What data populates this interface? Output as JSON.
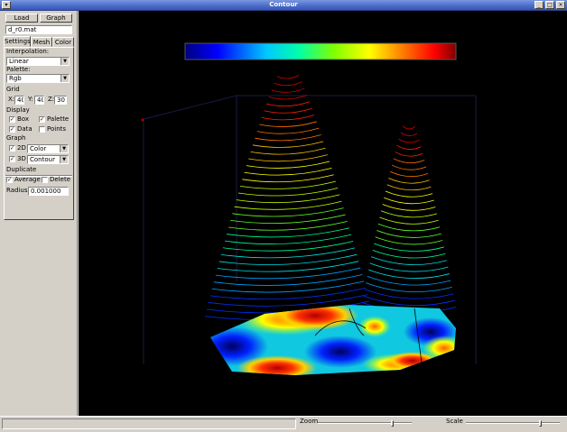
{
  "window": {
    "title": "Contour",
    "menu_glyph": "▾",
    "minimize_glyph": "_",
    "maximize_glyph": "□",
    "close_glyph": "×"
  },
  "toolbar": {
    "load_label": "Load",
    "graph_label": "Graph"
  },
  "file": {
    "value": "d_r0.mat"
  },
  "tabs": {
    "settings": "Settings",
    "mesh": "Mesh",
    "color": "Color",
    "active": "settings"
  },
  "settings": {
    "interpolation_label": "Interpolation:",
    "interpolation_value": "Linear",
    "palette_label": "Palette:",
    "palette_value": "Rgb",
    "grid_label": "Grid",
    "grid_x_label": "X:",
    "grid_x_value": "40",
    "grid_y_label": "Y:",
    "grid_y_value": "40",
    "grid_z_label": "Z:",
    "grid_z_value": "30",
    "display_label": "Display",
    "display_box_label": "Box",
    "display_box_checked": true,
    "display_palette_label": "Palette",
    "display_palette_checked": true,
    "display_data_label": "Data",
    "display_data_checked": true,
    "display_points_label": "Points",
    "display_points_checked": false,
    "graph_label": "Graph",
    "graph_2d_label": "2D",
    "graph_2d_checked": true,
    "graph_2d_mode": "Color",
    "graph_3d_label": "3D",
    "graph_3d_checked": true,
    "graph_3d_mode": "Contour",
    "duplicate_label": "Duplicate",
    "average_label": "Average",
    "average_checked": true,
    "delete_label": "Delete",
    "delete_checked": false,
    "radius_label": "Radius:",
    "radius_value": "0.001000",
    "check_glyph": "✓",
    "arrow_glyph": "▼"
  },
  "statusbar": {
    "zoom_label": "Zoom",
    "zoom_level": 0.82,
    "scale_label": "Scale",
    "scale_level": 0.82
  },
  "colors": {
    "viewport_bg": "#000000",
    "titlebar": "#4a6bc9"
  }
}
